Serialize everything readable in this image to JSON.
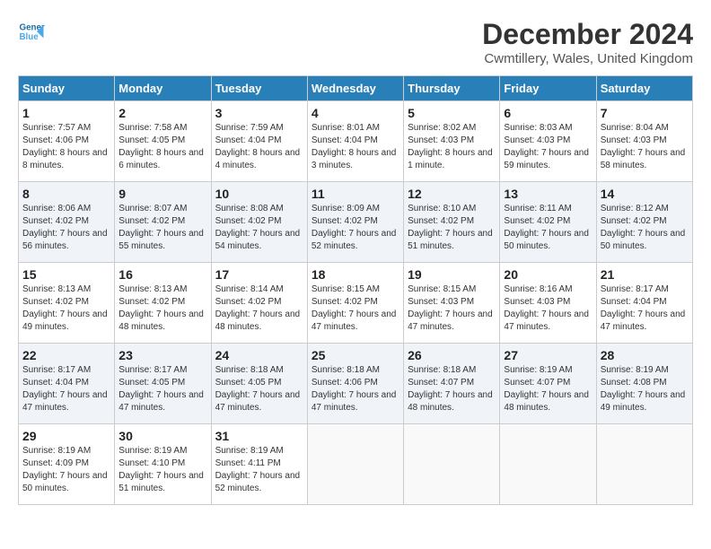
{
  "header": {
    "logo_line1": "General",
    "logo_line2": "Blue",
    "title": "December 2024",
    "subtitle": "Cwmtillery, Wales, United Kingdom"
  },
  "columns": [
    "Sunday",
    "Monday",
    "Tuesday",
    "Wednesday",
    "Thursday",
    "Friday",
    "Saturday"
  ],
  "weeks": [
    [
      {
        "day": "1",
        "sunrise": "Sunrise: 7:57 AM",
        "sunset": "Sunset: 4:06 PM",
        "daylight": "Daylight: 8 hours and 8 minutes."
      },
      {
        "day": "2",
        "sunrise": "Sunrise: 7:58 AM",
        "sunset": "Sunset: 4:05 PM",
        "daylight": "Daylight: 8 hours and 6 minutes."
      },
      {
        "day": "3",
        "sunrise": "Sunrise: 7:59 AM",
        "sunset": "Sunset: 4:04 PM",
        "daylight": "Daylight: 8 hours and 4 minutes."
      },
      {
        "day": "4",
        "sunrise": "Sunrise: 8:01 AM",
        "sunset": "Sunset: 4:04 PM",
        "daylight": "Daylight: 8 hours and 3 minutes."
      },
      {
        "day": "5",
        "sunrise": "Sunrise: 8:02 AM",
        "sunset": "Sunset: 4:03 PM",
        "daylight": "Daylight: 8 hours and 1 minute."
      },
      {
        "day": "6",
        "sunrise": "Sunrise: 8:03 AM",
        "sunset": "Sunset: 4:03 PM",
        "daylight": "Daylight: 7 hours and 59 minutes."
      },
      {
        "day": "7",
        "sunrise": "Sunrise: 8:04 AM",
        "sunset": "Sunset: 4:03 PM",
        "daylight": "Daylight: 7 hours and 58 minutes."
      }
    ],
    [
      {
        "day": "8",
        "sunrise": "Sunrise: 8:06 AM",
        "sunset": "Sunset: 4:02 PM",
        "daylight": "Daylight: 7 hours and 56 minutes."
      },
      {
        "day": "9",
        "sunrise": "Sunrise: 8:07 AM",
        "sunset": "Sunset: 4:02 PM",
        "daylight": "Daylight: 7 hours and 55 minutes."
      },
      {
        "day": "10",
        "sunrise": "Sunrise: 8:08 AM",
        "sunset": "Sunset: 4:02 PM",
        "daylight": "Daylight: 7 hours and 54 minutes."
      },
      {
        "day": "11",
        "sunrise": "Sunrise: 8:09 AM",
        "sunset": "Sunset: 4:02 PM",
        "daylight": "Daylight: 7 hours and 52 minutes."
      },
      {
        "day": "12",
        "sunrise": "Sunrise: 8:10 AM",
        "sunset": "Sunset: 4:02 PM",
        "daylight": "Daylight: 7 hours and 51 minutes."
      },
      {
        "day": "13",
        "sunrise": "Sunrise: 8:11 AM",
        "sunset": "Sunset: 4:02 PM",
        "daylight": "Daylight: 7 hours and 50 minutes."
      },
      {
        "day": "14",
        "sunrise": "Sunrise: 8:12 AM",
        "sunset": "Sunset: 4:02 PM",
        "daylight": "Daylight: 7 hours and 50 minutes."
      }
    ],
    [
      {
        "day": "15",
        "sunrise": "Sunrise: 8:13 AM",
        "sunset": "Sunset: 4:02 PM",
        "daylight": "Daylight: 7 hours and 49 minutes."
      },
      {
        "day": "16",
        "sunrise": "Sunrise: 8:13 AM",
        "sunset": "Sunset: 4:02 PM",
        "daylight": "Daylight: 7 hours and 48 minutes."
      },
      {
        "day": "17",
        "sunrise": "Sunrise: 8:14 AM",
        "sunset": "Sunset: 4:02 PM",
        "daylight": "Daylight: 7 hours and 48 minutes."
      },
      {
        "day": "18",
        "sunrise": "Sunrise: 8:15 AM",
        "sunset": "Sunset: 4:02 PM",
        "daylight": "Daylight: 7 hours and 47 minutes."
      },
      {
        "day": "19",
        "sunrise": "Sunrise: 8:15 AM",
        "sunset": "Sunset: 4:03 PM",
        "daylight": "Daylight: 7 hours and 47 minutes."
      },
      {
        "day": "20",
        "sunrise": "Sunrise: 8:16 AM",
        "sunset": "Sunset: 4:03 PM",
        "daylight": "Daylight: 7 hours and 47 minutes."
      },
      {
        "day": "21",
        "sunrise": "Sunrise: 8:17 AM",
        "sunset": "Sunset: 4:04 PM",
        "daylight": "Daylight: 7 hours and 47 minutes."
      }
    ],
    [
      {
        "day": "22",
        "sunrise": "Sunrise: 8:17 AM",
        "sunset": "Sunset: 4:04 PM",
        "daylight": "Daylight: 7 hours and 47 minutes."
      },
      {
        "day": "23",
        "sunrise": "Sunrise: 8:17 AM",
        "sunset": "Sunset: 4:05 PM",
        "daylight": "Daylight: 7 hours and 47 minutes."
      },
      {
        "day": "24",
        "sunrise": "Sunrise: 8:18 AM",
        "sunset": "Sunset: 4:05 PM",
        "daylight": "Daylight: 7 hours and 47 minutes."
      },
      {
        "day": "25",
        "sunrise": "Sunrise: 8:18 AM",
        "sunset": "Sunset: 4:06 PM",
        "daylight": "Daylight: 7 hours and 47 minutes."
      },
      {
        "day": "26",
        "sunrise": "Sunrise: 8:18 AM",
        "sunset": "Sunset: 4:07 PM",
        "daylight": "Daylight: 7 hours and 48 minutes."
      },
      {
        "day": "27",
        "sunrise": "Sunrise: 8:19 AM",
        "sunset": "Sunset: 4:07 PM",
        "daylight": "Daylight: 7 hours and 48 minutes."
      },
      {
        "day": "28",
        "sunrise": "Sunrise: 8:19 AM",
        "sunset": "Sunset: 4:08 PM",
        "daylight": "Daylight: 7 hours and 49 minutes."
      }
    ],
    [
      {
        "day": "29",
        "sunrise": "Sunrise: 8:19 AM",
        "sunset": "Sunset: 4:09 PM",
        "daylight": "Daylight: 7 hours and 50 minutes."
      },
      {
        "day": "30",
        "sunrise": "Sunrise: 8:19 AM",
        "sunset": "Sunset: 4:10 PM",
        "daylight": "Daylight: 7 hours and 51 minutes."
      },
      {
        "day": "31",
        "sunrise": "Sunrise: 8:19 AM",
        "sunset": "Sunset: 4:11 PM",
        "daylight": "Daylight: 7 hours and 52 minutes."
      },
      null,
      null,
      null,
      null
    ]
  ]
}
